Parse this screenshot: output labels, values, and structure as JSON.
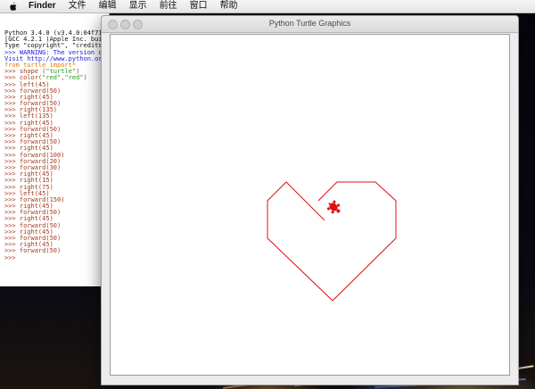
{
  "menubar": {
    "app_name": "Finder",
    "items": [
      "文件",
      "编辑",
      "显示",
      "前往",
      "窗口",
      "帮助"
    ]
  },
  "shell": {
    "lines": [
      {
        "text": "Python 3.4.0 (v3.4.0:04f714765",
        "color": "black"
      },
      {
        "text": "[GCC 4.2.1 (Apple Inc. build",
        "color": "black"
      },
      {
        "text": "Type \"copyright\", \"credits\"",
        "color": "black"
      },
      {
        "text": ">>> WARNING: The version of T",
        "color": "blue"
      },
      {
        "text": "Visit http://www.python.org/d",
        "color": "blue"
      },
      {
        "text": "from turtle import*",
        "color": "kw"
      },
      {
        "text": ">>> shape (\"turtle\")",
        "color": "prompt"
      },
      {
        "text": ">>> color(\"red\",\"red\")",
        "color": "prompt"
      },
      {
        "text": ">>> left(45)",
        "color": "prompt"
      },
      {
        "text": ">>> forward(50)",
        "color": "prompt"
      },
      {
        "text": ">>> right(45)",
        "color": "prompt"
      },
      {
        "text": ">>> forward(50)",
        "color": "prompt"
      },
      {
        "text": ">>> right(135)",
        "color": "prompt"
      },
      {
        "text": ">>> left(135)",
        "color": "prompt"
      },
      {
        "text": ">>> right(45)",
        "color": "prompt"
      },
      {
        "text": ">>> forward(50)",
        "color": "prompt"
      },
      {
        "text": ">>> right(45)",
        "color": "prompt"
      },
      {
        "text": ">>> forward(50)",
        "color": "prompt"
      },
      {
        "text": ">>> right(45)",
        "color": "prompt"
      },
      {
        "text": ">>> forward(100)",
        "color": "prompt"
      },
      {
        "text": ">>> forward(20)",
        "color": "prompt"
      },
      {
        "text": ">>> forward(30)",
        "color": "prompt"
      },
      {
        "text": ">>> right(45)",
        "color": "prompt"
      },
      {
        "text": ">>> right(15)",
        "color": "prompt"
      },
      {
        "text": ">>> right(75)",
        "color": "prompt"
      },
      {
        "text": ">>> left(45)",
        "color": "prompt"
      },
      {
        "text": ">>> forward(150)",
        "color": "prompt"
      },
      {
        "text": ">>> right(45)",
        "color": "prompt"
      },
      {
        "text": ">>> forward(50)",
        "color": "prompt"
      },
      {
        "text": ">>> right(45)",
        "color": "prompt"
      },
      {
        "text": ">>> forward(50)",
        "color": "prompt"
      },
      {
        "text": ">>> right(45)",
        "color": "prompt"
      },
      {
        "text": ">>> forward(50)",
        "color": "prompt"
      },
      {
        "text": ">>> right(45)",
        "color": "prompt"
      },
      {
        "text": ">>> forward(50)",
        "color": "prompt"
      },
      {
        "text": ">>>",
        "color": "prompt"
      }
    ]
  },
  "turtle_window": {
    "title": "Python Turtle Graphics",
    "pen_color": "#e01010",
    "turtle_color": "#e01010",
    "drawing_icon": "heart-drawing",
    "turtle_icon": "turtle-icon"
  },
  "colors": {
    "prompt": "#a33a1e",
    "blue": "#1a1ae0",
    "kw": "#e07b00",
    "string": "#1f9a1f"
  }
}
